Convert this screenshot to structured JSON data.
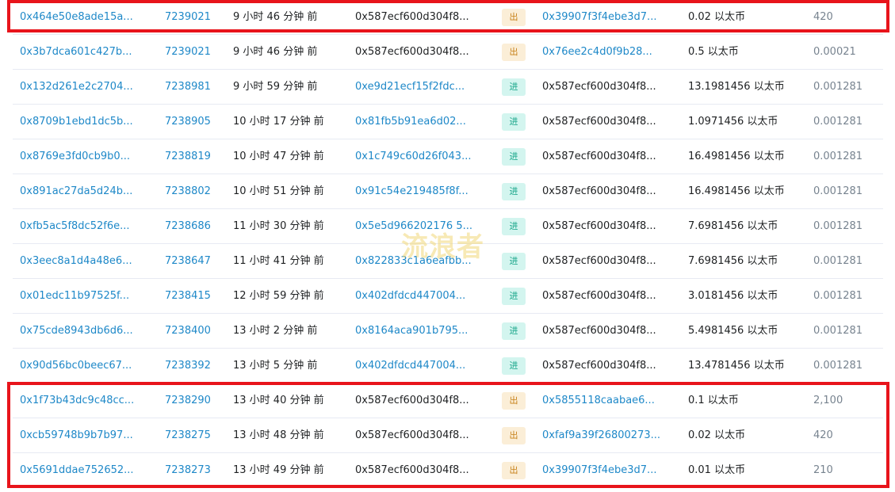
{
  "watermark": "流浪者",
  "rows": [
    {
      "hash": "0x464e50e8ade15a...",
      "block": "7239021",
      "age": "9 小时 46 分钟 前",
      "from": "0x587ecf600d304f8...",
      "dir": "出",
      "to": "0x39907f3f4ebe3d7...",
      "value": "0.02 以太币",
      "fee": "420"
    },
    {
      "hash": "0x3b7dca601c427b...",
      "block": "7239021",
      "age": "9 小时 46 分钟 前",
      "from": "0x587ecf600d304f8...",
      "dir": "出",
      "to": "0x76ee2c4d0f9b28...",
      "value": "0.5 以太币",
      "fee": "0.00021"
    },
    {
      "hash": "0x132d261e2c2704...",
      "block": "7238981",
      "age": "9 小时 59 分钟 前",
      "from": "0xe9d21ecf15f2fdc...",
      "dir": "进",
      "to": "0x587ecf600d304f8...",
      "value": "13.1981456 以太币",
      "fee": "0.001281"
    },
    {
      "hash": "0x8709b1ebd1dc5b...",
      "block": "7238905",
      "age": "10 小时 17 分钟 前",
      "from": "0x81fb5b91ea6d02...",
      "dir": "进",
      "to": "0x587ecf600d304f8...",
      "value": "1.0971456 以太币",
      "fee": "0.001281"
    },
    {
      "hash": "0x8769e3fd0cb9b0...",
      "block": "7238819",
      "age": "10 小时 47 分钟 前",
      "from": "0x1c749c60d26f043...",
      "dir": "进",
      "to": "0x587ecf600d304f8...",
      "value": "16.4981456 以太币",
      "fee": "0.001281"
    },
    {
      "hash": "0x891ac27da5d24b...",
      "block": "7238802",
      "age": "10 小时 51 分钟 前",
      "from": "0x91c54e219485f8f...",
      "dir": "进",
      "to": "0x587ecf600d304f8...",
      "value": "16.4981456 以太币",
      "fee": "0.001281"
    },
    {
      "hash": "0xfb5ac5f8dc52f6e...",
      "block": "7238686",
      "age": "11 小时 30 分钟 前",
      "from": "0x5e5d966202176 5...",
      "dir": "进",
      "to": "0x587ecf600d304f8...",
      "value": "7.6981456 以太币",
      "fee": "0.001281"
    },
    {
      "hash": "0x3eec8a1d4a48e6...",
      "block": "7238647",
      "age": "11 小时 41 分钟 前",
      "from": "0x822833c1a6eafbb...",
      "dir": "进",
      "to": "0x587ecf600d304f8...",
      "value": "7.6981456 以太币",
      "fee": "0.001281"
    },
    {
      "hash": "0x01edc11b97525f...",
      "block": "7238415",
      "age": "12 小时 59 分钟 前",
      "from": "0x402dfdcd447004...",
      "dir": "进",
      "to": "0x587ecf600d304f8...",
      "value": "3.0181456 以太币",
      "fee": "0.001281"
    },
    {
      "hash": "0x75cde8943db6d6...",
      "block": "7238400",
      "age": "13 小时 2 分钟 前",
      "from": "0x8164aca901b795...",
      "dir": "进",
      "to": "0x587ecf600d304f8...",
      "value": "5.4981456 以太币",
      "fee": "0.001281"
    },
    {
      "hash": "0x90d56bc0beec67...",
      "block": "7238392",
      "age": "13 小时 5 分钟 前",
      "from": "0x402dfdcd447004...",
      "dir": "进",
      "to": "0x587ecf600d304f8...",
      "value": "13.4781456 以太币",
      "fee": "0.001281"
    },
    {
      "hash": "0x1f73b43dc9c48cc...",
      "block": "7238290",
      "age": "13 小时 40 分钟 前",
      "from": "0x587ecf600d304f8...",
      "dir": "出",
      "to": "0x5855118caabae6...",
      "value": "0.1 以太币",
      "fee": "2,100"
    },
    {
      "hash": "0xcb59748b9b7b97...",
      "block": "7238275",
      "age": "13 小时 48 分钟 前",
      "from": "0x587ecf600d304f8...",
      "dir": "出",
      "to": "0xfaf9a39f26800273...",
      "value": "0.02 以太币",
      "fee": "420"
    },
    {
      "hash": "0x5691ddae752652...",
      "block": "7238273",
      "age": "13 小时 49 分钟 前",
      "from": "0x587ecf600d304f8...",
      "dir": "出",
      "to": "0x39907f3f4ebe3d7...",
      "value": "0.01 以太币",
      "fee": "210"
    }
  ],
  "highlighted_rows": [
    0,
    11,
    12,
    13
  ]
}
